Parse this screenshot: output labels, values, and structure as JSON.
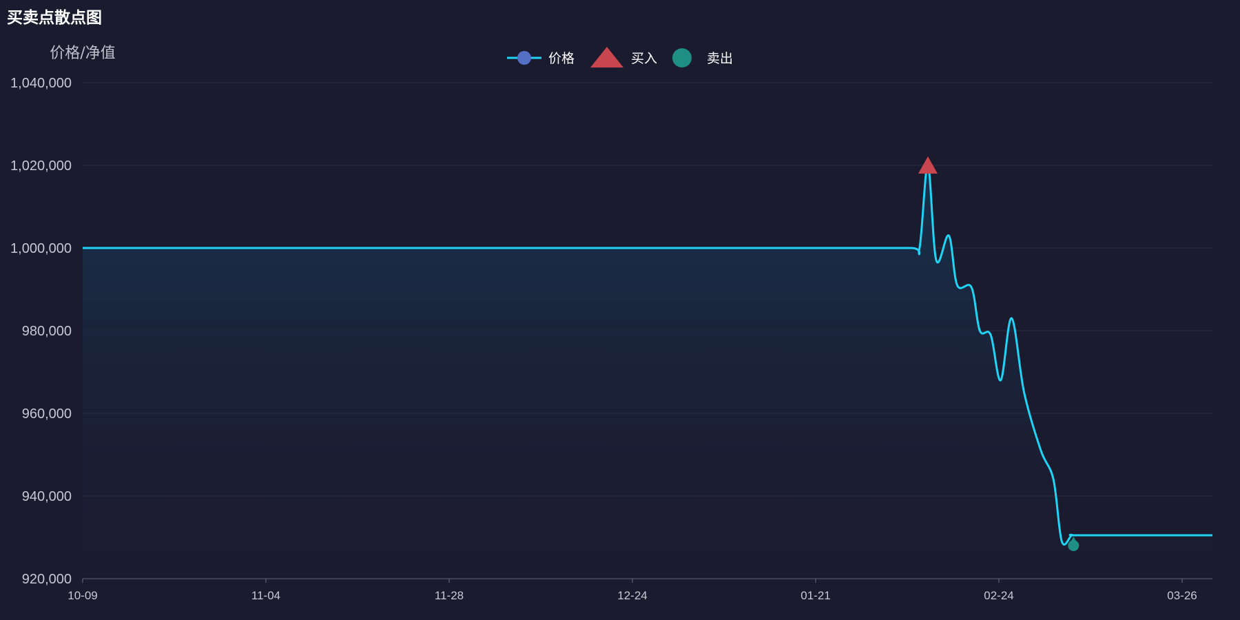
{
  "chart_data": {
    "type": "line",
    "title": "买卖点散点图",
    "ylabel": "价格/净值",
    "ylim": [
      920000,
      1040000
    ],
    "yticks": [
      920000,
      940000,
      960000,
      980000,
      1000000,
      1020000,
      1040000
    ],
    "ytick_labels": [
      "920,000",
      "940,000",
      "960,000",
      "980,000",
      "1,000,000",
      "1,020,000",
      "1,040,000"
    ],
    "x_tick_labels": [
      "10-09",
      "11-04",
      "11-28",
      "12-24",
      "01-21",
      "02-24",
      "03-26"
    ],
    "legend": {
      "position": "top-center",
      "items": [
        "价格",
        "买入",
        "卖出"
      ]
    },
    "colors": {
      "line": "#20d4f5",
      "legend_line_dot": "#5470c6",
      "buy": "#c9464e",
      "sell": "#1e8f82",
      "grid": "#2d2f45",
      "background": "#1b1b2f"
    },
    "grid": true,
    "series": [
      {
        "name": "价格",
        "type": "line",
        "values": [
          [
            0,
            1000000
          ],
          [
            100,
            1000000
          ],
          [
            200,
            1000000
          ],
          [
            300,
            1000000
          ],
          [
            400,
            1000000
          ],
          [
            500,
            1000000
          ],
          [
            600,
            1000000
          ],
          [
            700,
            1000000
          ],
          [
            800,
            1000000
          ],
          [
            900,
            1000000
          ],
          [
            990,
            1000000
          ],
          [
            1000,
            1000000
          ],
          [
            1010,
            1020000
          ],
          [
            1020,
            997000
          ],
          [
            1035,
            1003000
          ],
          [
            1045,
            991000
          ],
          [
            1062,
            990500
          ],
          [
            1072,
            980000
          ],
          [
            1085,
            979000
          ],
          [
            1097,
            968000
          ],
          [
            1110,
            983000
          ],
          [
            1125,
            965000
          ],
          [
            1145,
            951000
          ],
          [
            1160,
            944000
          ],
          [
            1170,
            929000
          ],
          [
            1182,
            930500
          ],
          [
            1190,
            930500
          ],
          [
            1300,
            930500
          ],
          [
            1350,
            930500
          ]
        ]
      },
      {
        "name": "买入",
        "type": "scatter",
        "points": [
          [
            1010,
            1020000
          ]
        ]
      },
      {
        "name": "卖出",
        "type": "scatter",
        "points": [
          [
            1184,
            928000
          ]
        ]
      }
    ]
  }
}
